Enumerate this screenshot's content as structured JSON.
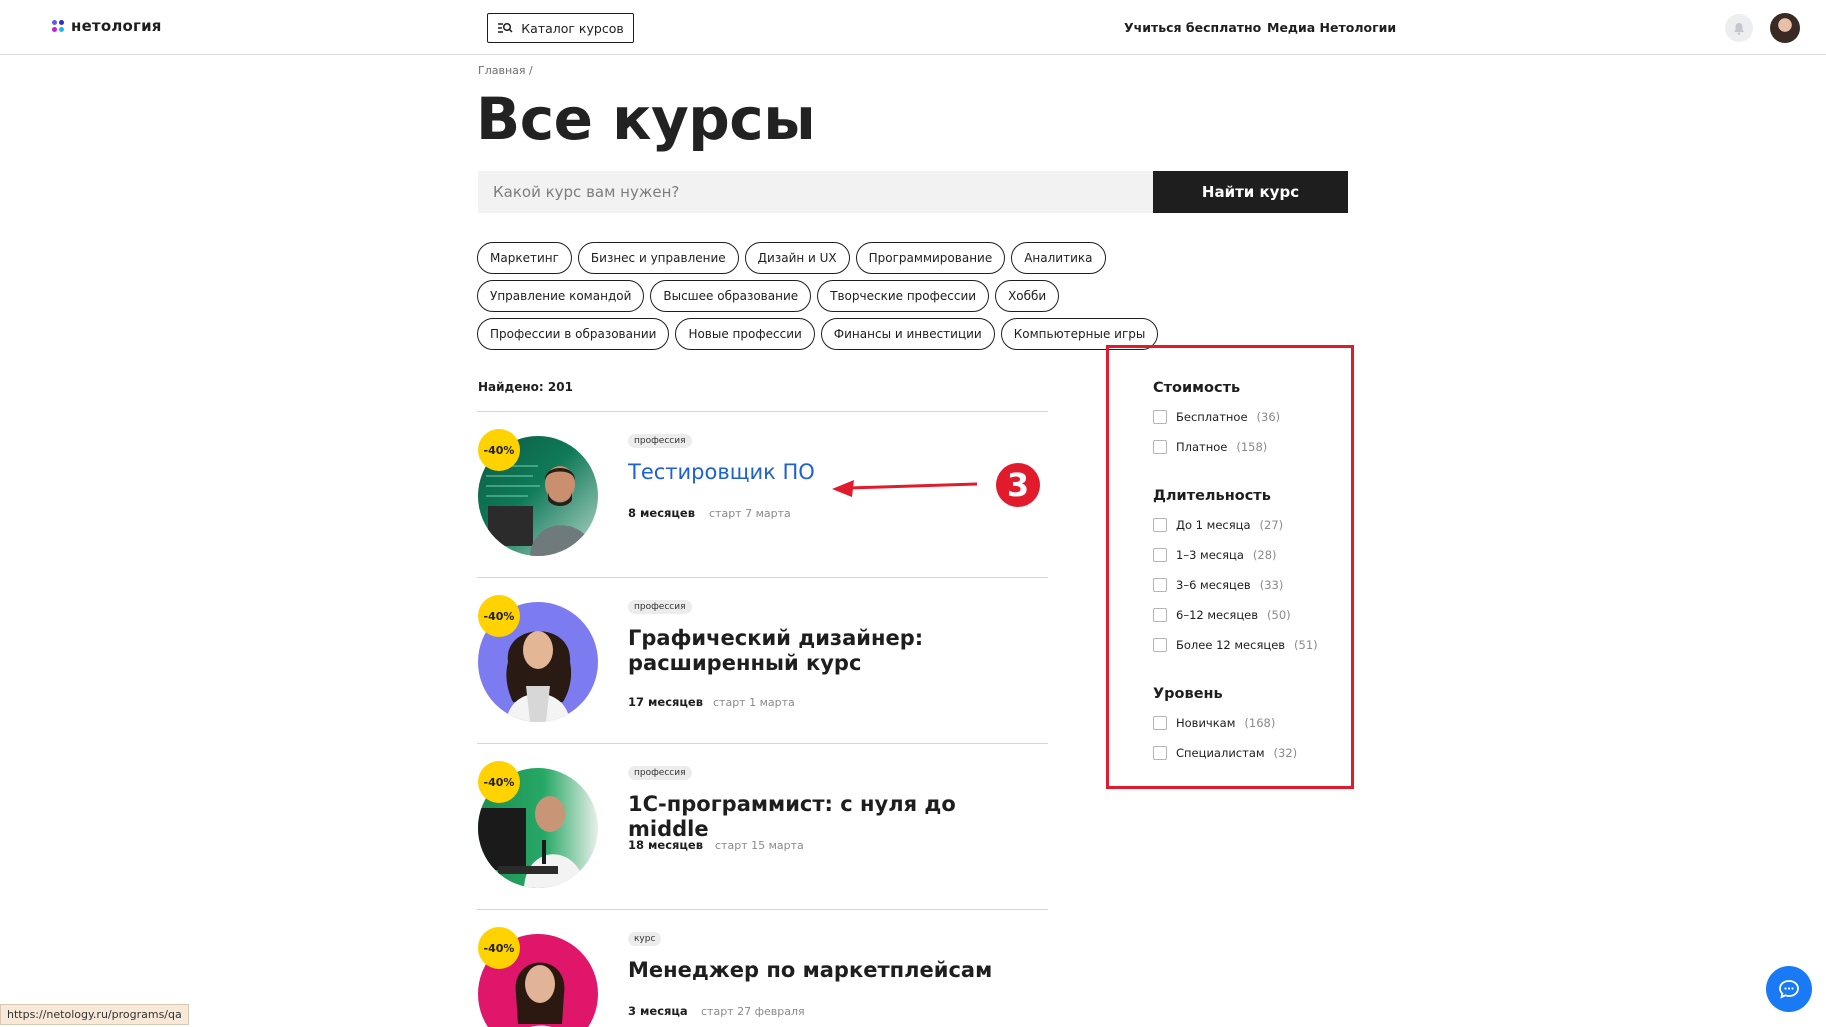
{
  "header": {
    "logo_text": "нетология",
    "catalog_label": "Каталог курсов",
    "nav": [
      "Учиться бесплатно",
      "Медиа Нетологии"
    ]
  },
  "breadcrumb": "Главная /",
  "title": "Все курсы",
  "search": {
    "placeholder": "Какой курс вам нужен?",
    "button": "Найти курс"
  },
  "tags": [
    "Маркетинг",
    "Бизнес и управление",
    "Дизайн и UX",
    "Программирование",
    "Аналитика",
    "Управление командой",
    "Высшее образование",
    "Творческие профессии",
    "Хобби",
    "Профессии в образовании",
    "Новые профессии",
    "Финансы и инвестиции",
    "Компьютерные игры"
  ],
  "found": "Найдено: 201",
  "courses": [
    {
      "badge": "-40%",
      "type": "профессия",
      "name": "Тестировщик ПО",
      "duration": "8 месяцев",
      "start": "старт 7 марта"
    },
    {
      "badge": "-40%",
      "type": "профессия",
      "name": "Графический дизайнер: расширенный курс",
      "duration": "17 месяцев",
      "start": "старт 1 марта"
    },
    {
      "badge": "-40%",
      "type": "профессия",
      "name": "1С-программист: с нуля до middle",
      "duration": "18 месяцев",
      "start": "старт 15 марта"
    },
    {
      "badge": "-40%",
      "type": "курс",
      "name": "Менеджер по маркетплейсам",
      "duration": "3 месяца",
      "start": "старт 27 февраля"
    }
  ],
  "filters": {
    "cost": {
      "title": "Стоимость",
      "items": [
        {
          "label": "Бесплатное",
          "count": "(36)"
        },
        {
          "label": "Платное",
          "count": "(158)"
        }
      ]
    },
    "duration": {
      "title": "Длительность",
      "items": [
        {
          "label": "До 1 месяца",
          "count": "(27)"
        },
        {
          "label": "1–3 месяца",
          "count": "(28)"
        },
        {
          "label": "3–6 месяцев",
          "count": "(33)"
        },
        {
          "label": "6–12 месяцев",
          "count": "(50)"
        },
        {
          "label": "Более 12 месяцев",
          "count": "(51)"
        }
      ]
    },
    "level": {
      "title": "Уровень",
      "items": [
        {
          "label": "Новичкам",
          "count": "(168)"
        },
        {
          "label": "Специалистам",
          "count": "(32)"
        }
      ]
    }
  },
  "annotation_number": "3",
  "status_url": "https://netology.ru/programs/qa",
  "colors": {
    "link_blue": "#1e62d1",
    "badge_yellow": "#ffd200",
    "highlight_red": "#e21b2c",
    "chat_blue": "#1a7af5"
  }
}
